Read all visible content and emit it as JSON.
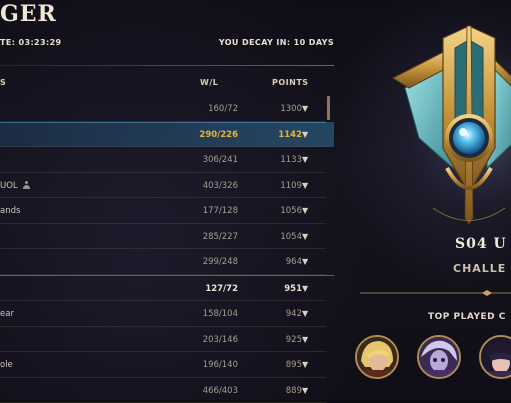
{
  "header": {
    "title": "GER",
    "update_text": "TE: 03:23:29",
    "decay_text": "YOU DECAY IN: 10 DAYS"
  },
  "table": {
    "columns": {
      "name": "S",
      "wl": "W/L",
      "points": "POINTS"
    },
    "rows": [
      {
        "name": "",
        "wl": "160/72",
        "points": "1300",
        "arrow": "▼",
        "state": "normal"
      },
      {
        "name": "",
        "wl": "290/226",
        "points": "1142",
        "arrow": "▼",
        "state": "selected"
      },
      {
        "name": "",
        "wl": "306/241",
        "points": "1133",
        "arrow": "▼",
        "state": "normal"
      },
      {
        "name": "UOL",
        "wl": "403/326",
        "points": "1109",
        "arrow": "▼",
        "state": "normal",
        "icon": "user-icon"
      },
      {
        "name": "ands",
        "wl": "177/128",
        "points": "1056",
        "arrow": "▼",
        "state": "normal"
      },
      {
        "name": "",
        "wl": "285/227",
        "points": "1054",
        "arrow": "▼",
        "state": "normal"
      },
      {
        "name": "",
        "wl": "299/248",
        "points": "964",
        "arrow": "▼",
        "state": "normal"
      },
      {
        "name": "",
        "wl": "127/72",
        "points": "951",
        "arrow": "▼",
        "state": "bold"
      },
      {
        "name": "ear",
        "wl": "158/104",
        "points": "942",
        "arrow": "▼",
        "state": "normal"
      },
      {
        "name": "",
        "wl": "203/146",
        "points": "925",
        "arrow": "▼",
        "state": "normal"
      },
      {
        "name": "ole",
        "wl": "196/140",
        "points": "895",
        "arrow": "▼",
        "state": "normal"
      },
      {
        "name": "",
        "wl": "466/403",
        "points": "889",
        "arrow": "▼",
        "state": "normal"
      }
    ]
  },
  "profile": {
    "season": "S04 U",
    "tier": "CHALLE",
    "top_played_label": "TOP PLAYED C",
    "emblem_icon": "challenger-emblem-icon",
    "champions": [
      "champion-portrait-blonde",
      "champion-portrait-purple",
      "champion-portrait-dark"
    ]
  },
  "colors": {
    "accent_gold": "#e8b53a",
    "selected_row": "#1f4a6e",
    "frame_gold": "#b08d4e"
  }
}
